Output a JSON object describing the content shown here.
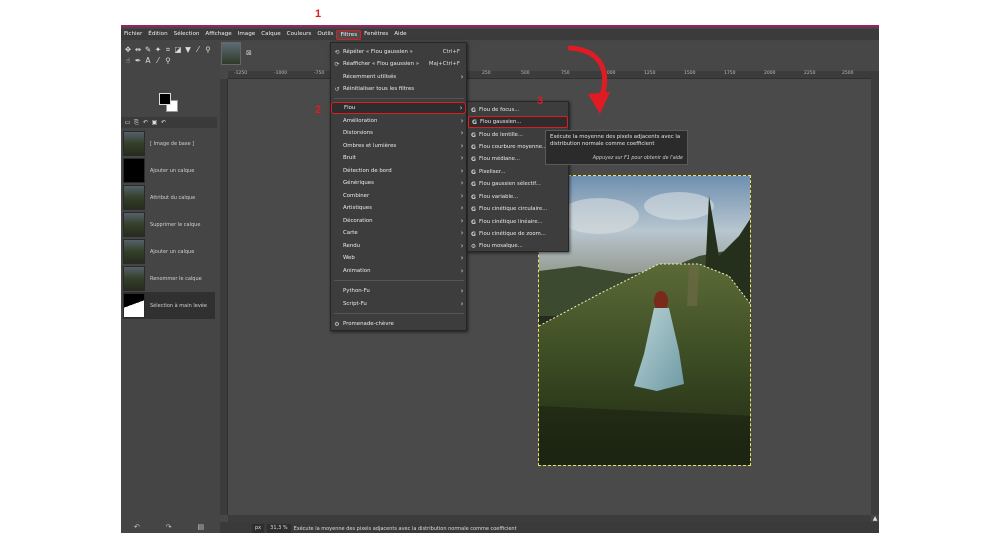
{
  "menubar": {
    "items": [
      "Fichier",
      "Édition",
      "Sélection",
      "Affichage",
      "Image",
      "Calque",
      "Couleurs",
      "Outils",
      "Filtres",
      "Fenêtres",
      "Aide"
    ],
    "active_index": 8
  },
  "annotations": [
    "1",
    "2",
    "3"
  ],
  "filters_menu": {
    "repeat": {
      "label": "Répéter « Flou gaussien »",
      "accel": "Ctrl+F"
    },
    "reshow": {
      "label": "Réafficher « Flou gaussien »",
      "accel": "Maj+Ctrl+F"
    },
    "recent": {
      "label": "Récemment utilisés"
    },
    "reset": {
      "label": "Réinitialiser tous les filtres"
    },
    "categories": [
      "Flou",
      "Amélioration",
      "Distorsions",
      "Ombres et lumières",
      "Bruit",
      "Détection de bord",
      "Génériques",
      "Combiner",
      "Artistiques",
      "Décoration",
      "Carte",
      "Rendu",
      "Web",
      "Animation"
    ],
    "scripts": [
      "Python-Fu",
      "Script-Fu"
    ],
    "goat": "Promenade-chèvre",
    "highlighted": "Flou"
  },
  "flou_menu": {
    "items": [
      "Flou de focus...",
      "Flou gaussien...",
      "Flou de lentille...",
      "Flou courbure moyenne...",
      "Flou médiane...",
      "Pixeliser...",
      "Flou gaussien sélectif...",
      "Flou variable...",
      "Flou cinétique circulaire...",
      "Flou cinétique linéaire...",
      "Flou cinétique de zoom...",
      "Flou mosaïque..."
    ],
    "highlighted": "Flou gaussien..."
  },
  "tooltip": {
    "text": "Exécute la moyenne des pixels adjacents avec la distribution normale comme coefficient",
    "help": "Appuyez sur F1 pour obtenir de l'aide"
  },
  "history": {
    "items": [
      {
        "label": "[ Image de base ]",
        "thumb": "photo"
      },
      {
        "label": "Ajouter un calque",
        "thumb": "black"
      },
      {
        "label": "Attribut du calque",
        "thumb": "photo"
      },
      {
        "label": "Supprimer le calque",
        "thumb": "photo"
      },
      {
        "label": "Ajouter un calque",
        "thumb": "photo"
      },
      {
        "label": "Renommer le calque",
        "thumb": "photo"
      },
      {
        "label": "Sélection à main levée",
        "thumb": "mask"
      }
    ],
    "selected_index": 6
  },
  "ruler": {
    "labels": [
      "-1250",
      "-1000",
      "-750",
      "250",
      "500",
      "750",
      "1000",
      "1250",
      "1500",
      "1750",
      "2000",
      "2250",
      "2500"
    ]
  },
  "status": {
    "unit": "px",
    "zoom": "31,3 %",
    "message": "Exécute la moyenne des pixels adjacents avec la distribution normale comme coefficient"
  },
  "colors": {
    "accent": "#e01b24",
    "app_bg": "#454545",
    "menu_bg": "#3d3d3d",
    "selection": "#e8e35a"
  }
}
